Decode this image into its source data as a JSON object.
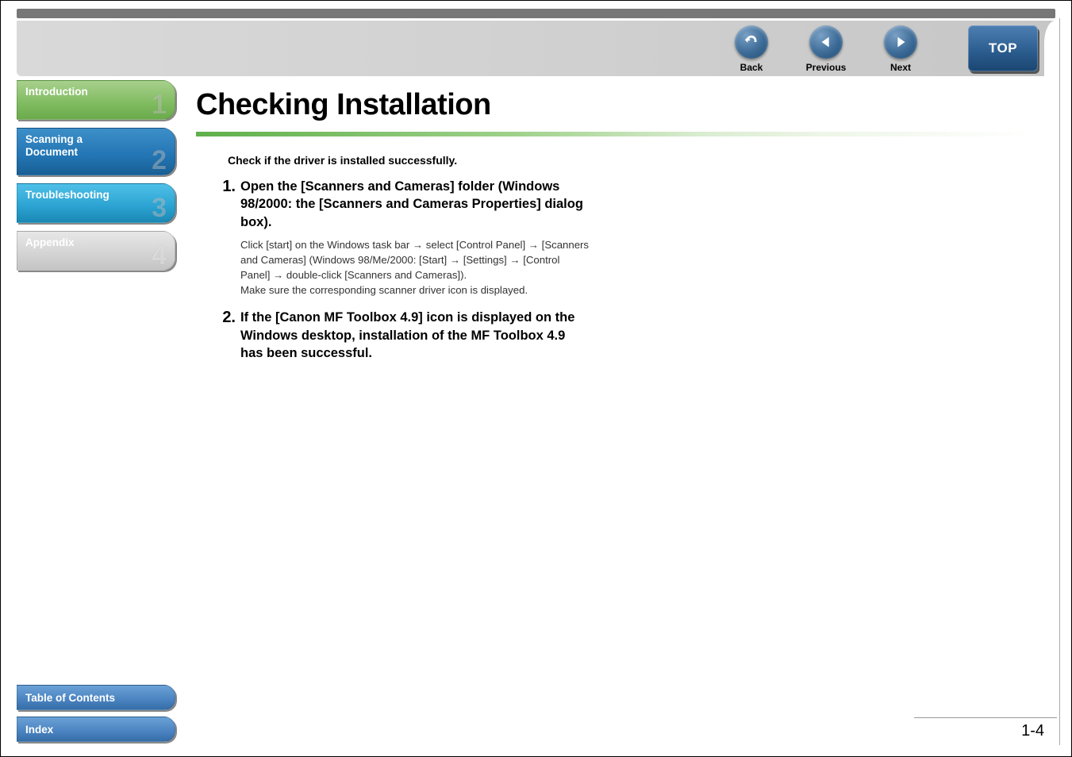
{
  "header": {
    "back": {
      "label": "Back"
    },
    "prev": {
      "label": "Previous"
    },
    "next": {
      "label": "Next"
    },
    "top": {
      "label": "TOP"
    }
  },
  "sidebar": {
    "items": [
      {
        "label": "Introduction",
        "num": "1"
      },
      {
        "label": "Scanning a\nDocument",
        "num": "2"
      },
      {
        "label": "Troubleshooting",
        "num": "3"
      },
      {
        "label": "Appendix",
        "num": "4"
      }
    ],
    "toc": {
      "label": "Table of Contents"
    },
    "index": {
      "label": "Index"
    }
  },
  "main": {
    "title": "Checking Installation",
    "intro": "Check if the driver is installed successfully.",
    "steps": [
      {
        "num": "1.",
        "heading": "Open the [Scanners and Cameras] folder (Windows 98/2000: the [Scanners and Cameras Properties] dialog box).",
        "detail": "Click [start] on the Windows task bar → select [Control Panel] → [Scanners and Cameras] (Windows 98/Me/2000: [Start] → [Settings] → [Control Panel] → double-click [Scanners and Cameras]).\nMake sure the corresponding scanner driver icon is displayed."
      },
      {
        "num": "2.",
        "heading": "If the [Canon MF Toolbox 4.9] icon is displayed on the Windows desktop, installation of the MF Toolbox 4.9 has been successful.",
        "detail": ""
      }
    ],
    "page_number": "1-4"
  }
}
